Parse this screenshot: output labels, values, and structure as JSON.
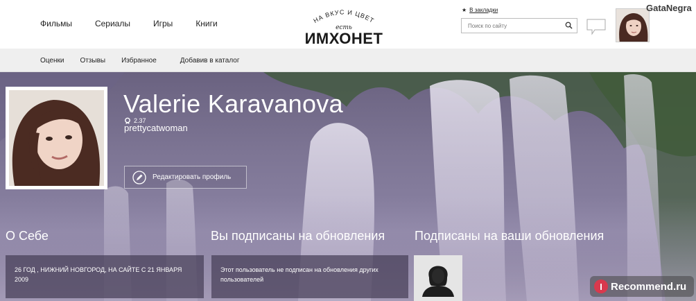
{
  "header": {
    "nav": [
      "Фильмы",
      "Сериалы",
      "Игры",
      "Книги"
    ],
    "logo": {
      "arc": "НА ВКУС И ЦВЕТ",
      "est": "есть",
      "name": "ИМХОНЕТ"
    },
    "bookmark": {
      "icon": "star-icon",
      "label": "В закладки"
    },
    "search": {
      "placeholder": "Поиск по сайту",
      "icon": "search-icon"
    },
    "messages_icon": "speech-bubble-icon",
    "username": "GataNegra"
  },
  "subnav": [
    "Оценки",
    "Отзывы",
    "Избранное",
    "Добавив в каталог"
  ],
  "profile": {
    "name": "Valerie Karavanova",
    "rating": "2.37",
    "nickname": "prettycatwoman",
    "edit_button": "Редактировать профиль"
  },
  "sections": {
    "about": {
      "title": "О Себе",
      "text": "26 ГОД , НИЖНИЙ НОВГОРОД, НА САЙТЕ С 21 ЯНВАРЯ 2009"
    },
    "subscribed": {
      "title": "Вы подписаны на обновления",
      "text": "Этот пользователь не подписан на обновления других пользователей"
    },
    "followers": {
      "title": "Подписаны на ваши обновления"
    }
  },
  "watermark": {
    "badge": "I",
    "text": "Recommend.ru"
  },
  "colors": {
    "hero_overlay": "#7d7594",
    "card": "#463e58",
    "watermark_badge": "#d9394d"
  }
}
